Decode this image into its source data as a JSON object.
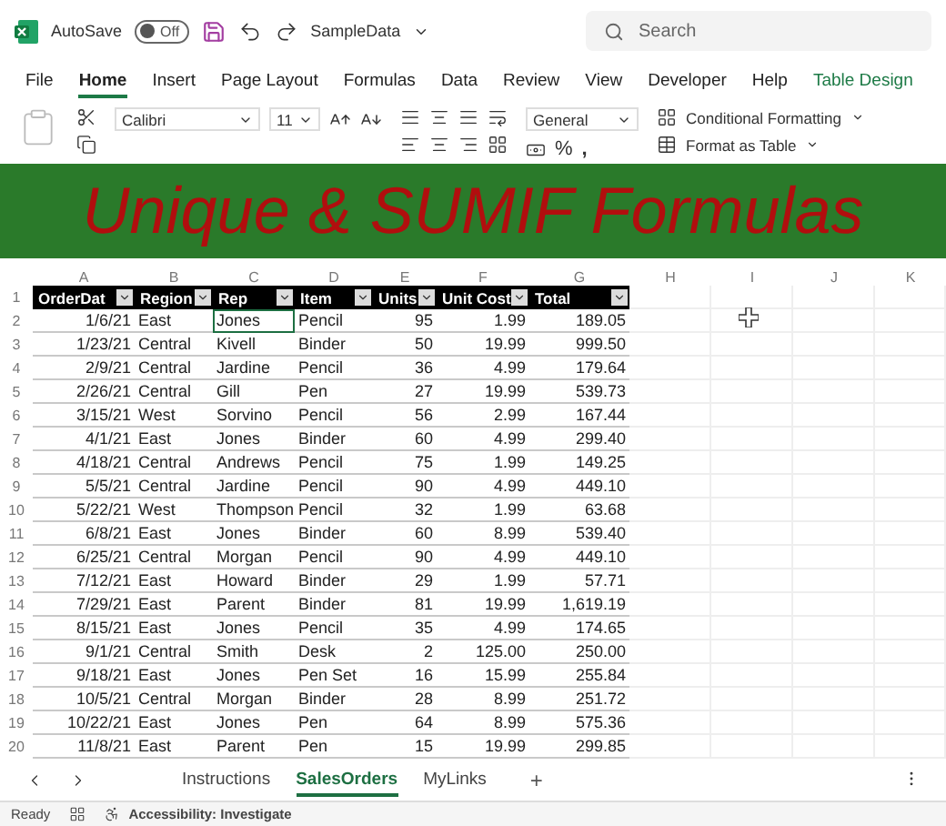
{
  "title_bar": {
    "autosave_label": "AutoSave",
    "autosave_on": false,
    "autosave_state": "Off",
    "file_name": "SampleData",
    "search_placeholder": "Search"
  },
  "menu_tabs": [
    {
      "label": "File",
      "selected": false,
      "kind": "standard"
    },
    {
      "label": "Home",
      "selected": true,
      "kind": "standard"
    },
    {
      "label": "Insert",
      "selected": false,
      "kind": "standard"
    },
    {
      "label": "Page Layout",
      "selected": false,
      "kind": "standard"
    },
    {
      "label": "Formulas",
      "selected": false,
      "kind": "standard"
    },
    {
      "label": "Data",
      "selected": false,
      "kind": "standard"
    },
    {
      "label": "Review",
      "selected": false,
      "kind": "standard"
    },
    {
      "label": "View",
      "selected": false,
      "kind": "standard"
    },
    {
      "label": "Developer",
      "selected": false,
      "kind": "standard"
    },
    {
      "label": "Help",
      "selected": false,
      "kind": "standard"
    },
    {
      "label": "Table Design",
      "selected": false,
      "kind": "contextual"
    }
  ],
  "ribbon": {
    "font_name": "Calibri",
    "font_size": "11",
    "number_format": "General",
    "percent": "%",
    "comma": ",",
    "style_commands": [
      "Conditional Formatting",
      "Format as Table"
    ]
  },
  "banner": {
    "title": "Unique & SUMIF Formulas"
  },
  "sheet": {
    "columns": [
      "A",
      "B",
      "C",
      "D",
      "E",
      "F",
      "G",
      "H",
      "I",
      "J",
      "K"
    ],
    "header_row": "1",
    "headers": [
      "OrderDat",
      "Region",
      "Rep",
      "Item",
      "Units",
      "Unit Cost",
      "Total"
    ],
    "rows": [
      {
        "number": "2",
        "selected": true,
        "cells": [
          "1/6/21",
          "East",
          "Jones",
          "Pencil",
          "95",
          "1.99",
          "189.05"
        ]
      },
      {
        "number": "3",
        "selected": false,
        "cells": [
          "1/23/21",
          "Central",
          "Kivell",
          "Binder",
          "50",
          "19.99",
          "999.50"
        ]
      },
      {
        "number": "4",
        "selected": false,
        "cells": [
          "2/9/21",
          "Central",
          "Jardine",
          "Pencil",
          "36",
          "4.99",
          "179.64"
        ]
      },
      {
        "number": "5",
        "selected": false,
        "cells": [
          "2/26/21",
          "Central",
          "Gill",
          "Pen",
          "27",
          "19.99",
          "539.73"
        ]
      },
      {
        "number": "6",
        "selected": false,
        "cells": [
          "3/15/21",
          "West",
          "Sorvino",
          "Pencil",
          "56",
          "2.99",
          "167.44"
        ]
      },
      {
        "number": "7",
        "selected": false,
        "cells": [
          "4/1/21",
          "East",
          "Jones",
          "Binder",
          "60",
          "4.99",
          "299.40"
        ]
      },
      {
        "number": "8",
        "selected": false,
        "cells": [
          "4/18/21",
          "Central",
          "Andrews",
          "Pencil",
          "75",
          "1.99",
          "149.25"
        ]
      },
      {
        "number": "9",
        "selected": false,
        "cells": [
          "5/5/21",
          "Central",
          "Jardine",
          "Pencil",
          "90",
          "4.99",
          "449.10"
        ]
      },
      {
        "number": "10",
        "selected": false,
        "cells": [
          "5/22/21",
          "West",
          "Thompson",
          "Pencil",
          "32",
          "1.99",
          "63.68"
        ]
      },
      {
        "number": "11",
        "selected": false,
        "cells": [
          "6/8/21",
          "East",
          "Jones",
          "Binder",
          "60",
          "8.99",
          "539.40"
        ]
      },
      {
        "number": "12",
        "selected": false,
        "cells": [
          "6/25/21",
          "Central",
          "Morgan",
          "Pencil",
          "90",
          "4.99",
          "449.10"
        ]
      },
      {
        "number": "13",
        "selected": false,
        "cells": [
          "7/12/21",
          "East",
          "Howard",
          "Binder",
          "29",
          "1.99",
          "57.71"
        ]
      },
      {
        "number": "14",
        "selected": false,
        "cells": [
          "7/29/21",
          "East",
          "Parent",
          "Binder",
          "81",
          "19.99",
          "1,619.19"
        ]
      },
      {
        "number": "15",
        "selected": false,
        "cells": [
          "8/15/21",
          "East",
          "Jones",
          "Pencil",
          "35",
          "4.99",
          "174.65"
        ]
      },
      {
        "number": "16",
        "selected": false,
        "cells": [
          "9/1/21",
          "Central",
          "Smith",
          "Desk",
          "2",
          "125.00",
          "250.00"
        ]
      },
      {
        "number": "17",
        "selected": false,
        "cells": [
          "9/18/21",
          "East",
          "Jones",
          "Pen Set",
          "16",
          "15.99",
          "255.84"
        ]
      },
      {
        "number": "18",
        "selected": false,
        "cells": [
          "10/5/21",
          "Central",
          "Morgan",
          "Binder",
          "28",
          "8.99",
          "251.72"
        ]
      },
      {
        "number": "19",
        "selected": false,
        "cells": [
          "10/22/21",
          "East",
          "Jones",
          "Pen",
          "64",
          "8.99",
          "575.36"
        ]
      },
      {
        "number": "20",
        "selected": false,
        "cells": [
          "11/8/21",
          "East",
          "Parent",
          "Pen",
          "15",
          "19.99",
          "299.85"
        ]
      }
    ]
  },
  "sheet_tabs": [
    {
      "label": "Instructions",
      "selected": false
    },
    {
      "label": "SalesOrders",
      "selected": true
    },
    {
      "label": "MyLinks",
      "selected": false
    }
  ],
  "add_sheet": "+",
  "status_bar": {
    "mode": "Ready",
    "accessibility": "Accessibility: Investigate"
  }
}
